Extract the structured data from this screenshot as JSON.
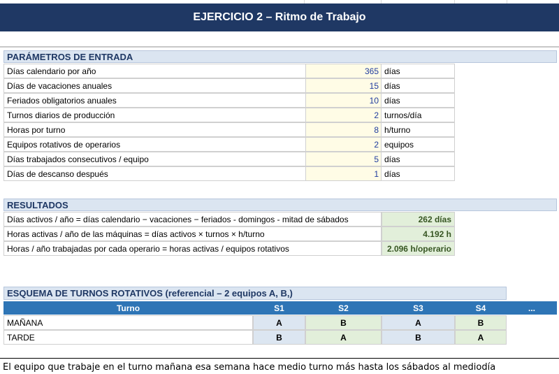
{
  "title": "EJERCICIO 2 – Ritmo de Trabajo",
  "params": {
    "header": "PARÁMETROS DE ENTRADA",
    "rows": [
      {
        "label": "Días calendario por año",
        "value": "365",
        "unit": "días"
      },
      {
        "label": "Días de vacaciones anuales",
        "value": "15",
        "unit": "días"
      },
      {
        "label": "Feriados obligatorios anuales",
        "value": "10",
        "unit": "días"
      },
      {
        "label": "Turnos diarios de producción",
        "value": "2",
        "unit": "turnos/día"
      },
      {
        "label": "Horas por turno",
        "value": "8",
        "unit": "h/turno"
      },
      {
        "label": "Equipos rotativos de operarios",
        "value": "2",
        "unit": "equipos"
      },
      {
        "label": "Días trabajados consecutivos / equipo",
        "value": "5",
        "unit": "días"
      },
      {
        "label": "Días de descanso después",
        "value": "1",
        "unit": "días"
      }
    ]
  },
  "results": {
    "header": "RESULTADOS",
    "rows": [
      {
        "label": "Días activos / año = días calendario − vacaciones − feriados - domingos - mitad de sábados",
        "value": "262 días"
      },
      {
        "label": "Horas activas / año de las máquinas = días activos × turnos × h/turno",
        "value": "4.192 h"
      },
      {
        "label": "Horas / año trabajadas por cada operario = horas activas / equipos rotativos",
        "value": "2.096 h/operario"
      }
    ]
  },
  "schedule": {
    "header": "ESQUEMA DE TURNOS ROTATIVOS  (referencial – 2 equipos A, B,)",
    "columns": [
      "Turno",
      "S1",
      "S2",
      "S3",
      "S4",
      "..."
    ],
    "rows": [
      {
        "label": "MAÑANA",
        "cells": [
          "A",
          "B",
          "A",
          "B"
        ]
      },
      {
        "label": "TARDE",
        "cells": [
          "B",
          "A",
          "B",
          "A"
        ]
      }
    ]
  },
  "note": "El equipo que trabaje en el turno mañana esa semana hace medio turno más hasta los sábados al mediodía"
}
